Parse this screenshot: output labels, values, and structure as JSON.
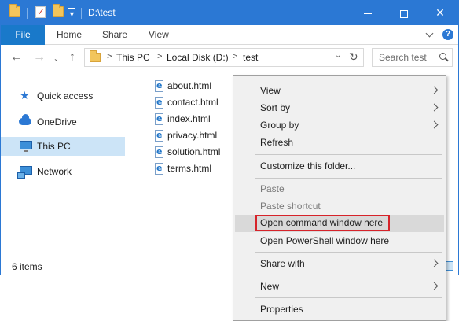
{
  "window": {
    "title": "D:\\test",
    "min_icon": "minimize-icon",
    "max_icon": "maximize-icon",
    "close_icon": "close-icon",
    "close_glyph": "✕"
  },
  "ribbon": {
    "file_tab": "File",
    "tabs": [
      "Home",
      "Share",
      "View"
    ],
    "help": "?"
  },
  "address": {
    "back": "←",
    "forward": "→",
    "recent": "⌄",
    "up": "↑",
    "sep": ">",
    "crumbs": [
      "This PC",
      "Local Disk (D:)",
      "test"
    ],
    "dropdown": "⌄",
    "refresh": "↻"
  },
  "search": {
    "placeholder": "Search test"
  },
  "navpane": {
    "items": [
      {
        "label": "Quick access",
        "icon": "star-icon"
      },
      {
        "label": "OneDrive",
        "icon": "cloud-icon"
      },
      {
        "label": "This PC",
        "icon": "computer-icon",
        "selected": true
      },
      {
        "label": "Network",
        "icon": "network-icon"
      }
    ],
    "star_glyph": "★"
  },
  "files": [
    "about.html",
    "contact.html",
    "index.html",
    "privacy.html",
    "solution.html",
    "terms.html"
  ],
  "status": {
    "item_count": "6 items"
  },
  "context_menu": {
    "items": [
      {
        "label": "View",
        "submenu": true
      },
      {
        "label": "Sort by",
        "submenu": true
      },
      {
        "label": "Group by",
        "submenu": true
      },
      {
        "label": "Refresh"
      },
      {
        "label": "Customize this folder..."
      },
      {
        "label": "Paste",
        "disabled": true
      },
      {
        "label": "Paste shortcut",
        "disabled": true
      },
      {
        "label": "Open command window here",
        "highlighted": true
      },
      {
        "label": "Open PowerShell window here"
      },
      {
        "label": "Share with",
        "submenu": true
      },
      {
        "label": "New",
        "submenu": true
      },
      {
        "label": "Properties"
      }
    ]
  },
  "colors": {
    "titlebar": "#2b78d4",
    "file_tab": "#1979ca",
    "selection": "#cce4f7",
    "highlight_outline": "#d6232a"
  }
}
